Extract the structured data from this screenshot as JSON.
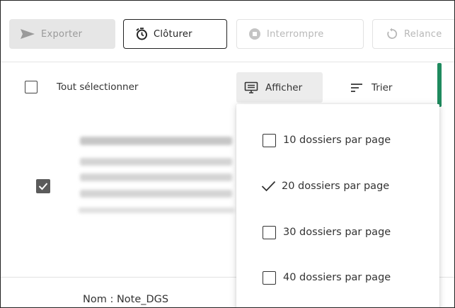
{
  "toolbar": {
    "export_label": "Exporter",
    "close_label": "Clôturer",
    "stop_label": "Interrompre",
    "relaunch_label": "Relance"
  },
  "actions": {
    "select_all_label": "Tout sélectionner",
    "display_label": "Afficher",
    "sort_label": "Trier"
  },
  "rows": [
    {
      "selected": true
    },
    {
      "name_label": "Nom : Note_DGS"
    }
  ],
  "page_size_menu": {
    "options": [
      {
        "label": "10 dossiers par page",
        "selected": false
      },
      {
        "label": "20 dossiers par page",
        "selected": true
      },
      {
        "label": "30 dossiers par page",
        "selected": false
      },
      {
        "label": "40 dossiers par page",
        "selected": false
      }
    ]
  },
  "colors": {
    "accent_green": "#1f8a5e",
    "checkbox_checked": "#5b5b5b",
    "button_disabled_bg": "#e6e6e6"
  }
}
